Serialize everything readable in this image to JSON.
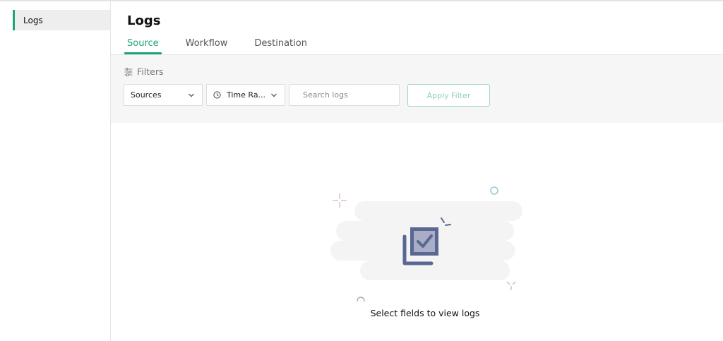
{
  "sidebar": {
    "items": [
      {
        "label": "Logs",
        "active": true
      }
    ]
  },
  "main": {
    "title": "Logs",
    "tabs": [
      {
        "label": "Source",
        "active": true
      },
      {
        "label": "Workflow",
        "active": false
      },
      {
        "label": "Destination",
        "active": false
      }
    ]
  },
  "filters": {
    "title": "Filters",
    "sources_dropdown": {
      "value": "Sources"
    },
    "time_range_dropdown": {
      "value": "Time Ra..."
    },
    "search": {
      "placeholder": "Search logs",
      "value": ""
    },
    "apply_label": "Apply Filter"
  },
  "empty_state": {
    "message": "Select fields to view logs"
  },
  "colors": {
    "accent": "#1fa37a",
    "illustration": "#5b6793",
    "panel_bg": "#f6f6f6"
  },
  "icons": {
    "filters": "sliders-icon",
    "dropdown": "chevron-down-icon",
    "time": "clock-icon",
    "empty": "checked-images-icon"
  }
}
